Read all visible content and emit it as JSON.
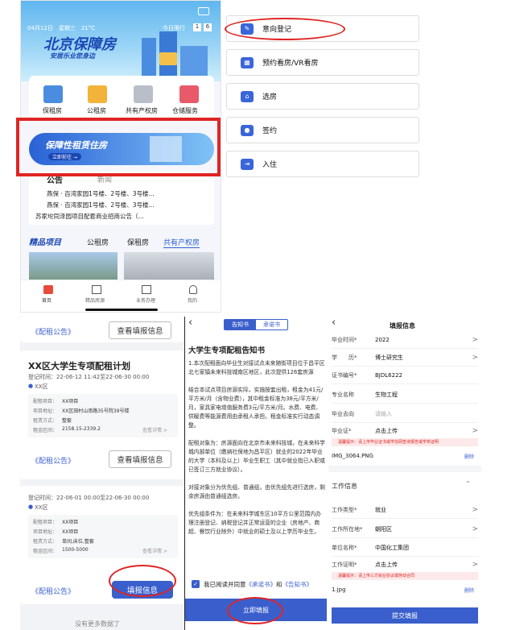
{
  "phone1": {
    "status_left": "04月12日　星期三　21°C",
    "status_right": "今日限行",
    "limit_nums": [
      "1",
      "6"
    ],
    "brand_title": "北京保障房",
    "brand_slogan": "安居乐业您身边",
    "categories": [
      {
        "label": "保租房"
      },
      {
        "label": "公租房"
      },
      {
        "label": "共有产权房"
      },
      {
        "label": "仓储服务"
      }
    ],
    "banner_title": "保障性租赁住房",
    "banner_btn": "立即前往 →",
    "notice_tabs": [
      "公告",
      "新闻"
    ],
    "notices": [
      "燕保 · 百湾家园1号楼、2号楼、3号楼...",
      "燕保 · 百湾家园1号楼、2号楼、3号楼...",
      "苏家坨同泽园项目配套商业招商公告（..."
    ],
    "sections": [
      "精品项目",
      "公租房",
      "保租房",
      "共有产权房"
    ],
    "bottom_nav": [
      "首页",
      "精品房源",
      "业务办理",
      "我的"
    ]
  },
  "menu": [
    {
      "label": "意向登记",
      "icon": "register-icon"
    },
    {
      "label": "预约看房/VR看房",
      "icon": "calendar-icon"
    },
    {
      "label": "选房",
      "icon": "house-icon"
    },
    {
      "label": "签约",
      "icon": "user-sign-icon"
    },
    {
      "label": "入住",
      "icon": "move-in-icon"
    }
  ],
  "list": {
    "top_link": "《配租公告》",
    "top_btn": "查看填报信息",
    "plan_title": "XX区大学生专项配租计划",
    "plan1_time": "登记时间：22-06-12 11:42至22-06-30 00:00",
    "plan1_area": "XX区",
    "plan1_rows": [
      [
        "配租项目：",
        "XX项目"
      ],
      [
        "项目地址：",
        "XX区田村山南路35号院39号楼"
      ],
      [
        "租赁方式：",
        "整套"
      ],
      [
        "租金区间：",
        "2158.15-2339.2"
      ]
    ],
    "more": "查看详情 >",
    "plan2_time": "登记时间：22-06-01 00:00至22-06-30 00:00",
    "plan2_area": "XX区",
    "plan2_rows": [
      [
        "配租项目：",
        "XX项目"
      ],
      [
        "项目地址：",
        "XX项目"
      ],
      [
        "租赁方式：",
        "单间,床位,整套"
      ],
      [
        "租金区间：",
        "1500-5000"
      ]
    ],
    "fill_btn": "填报信息",
    "footer": "没有更多数据了"
  },
  "notice": {
    "tab1": "告知书",
    "tab2": "承诺书",
    "title": "大学生专项配租告知书",
    "paras": [
      "1.本次配租面向毕业生对接试点未来随街项目位于昌平区北七家镇未来科技城南区地区，此次提供126套房源",
      "结合本试点项目房源实际，实施按套出租，租金为41元/平方米/月（含物业费），其中租金标准为38元/平方米/月，家具家电增值服务费3元/平方米/月。水费、电费、供暖费等能源费用由承租人承担。租金标准实行动态调整。",
      "配租对象为：房源面向在北京市未来科技城，在未来科学城内部单位（缴纳社保地为昌平区）就业的2022年毕业的大学（本科及以上）毕业生职工（其中就业指已入职或已签订三方就业协议）。",
      "对接对象分为优先组、普通组，由优先组先进行选房，剩余房源由普通组选房。",
      "优先组条件为：在未来科学城东区10平方公里范围内办理注册登记、纳税登记并正常运营的企业（房地产、商超、餐饮行业除外）中就业的硕士及以上学历毕业生。"
    ],
    "agree_prefix": "我已阅读并同意",
    "agree_link1": "《承诺书》",
    "agree_and": "和",
    "agree_link2": "《告知书》",
    "submit": "立即填报"
  },
  "form": {
    "title": "填报信息",
    "rows": [
      [
        "毕业时间*",
        "2022",
        ">"
      ],
      [
        "学　　历*",
        "博士研究生",
        ">"
      ],
      [
        "证书编号*",
        "BJDL6222",
        ""
      ],
      [
        "专业名称",
        "生物工程",
        ""
      ],
      [
        "毕业去向",
        "请输入",
        ""
      ],
      [
        "毕业证*",
        "点击上传",
        ">"
      ]
    ],
    "hint1": "温馨提示：请上传毕业证书或学信网查询报告或学校证明",
    "file1": "IMG_3064.PNG",
    "del": "删除",
    "work_section": "工作信息",
    "work_rows": [
      [
        "工作类型*",
        "就业",
        ">"
      ],
      [
        "工作所在地*",
        "朝阳区",
        ">"
      ],
      [
        "单位名称*",
        "中国化工集团",
        ""
      ],
      [
        "工作证明*",
        "点击上传",
        ">"
      ]
    ],
    "hint2": "温馨提示：请上传三方就业协议或劳动合同",
    "file2": "1.jpg",
    "submit": "提交填报"
  }
}
